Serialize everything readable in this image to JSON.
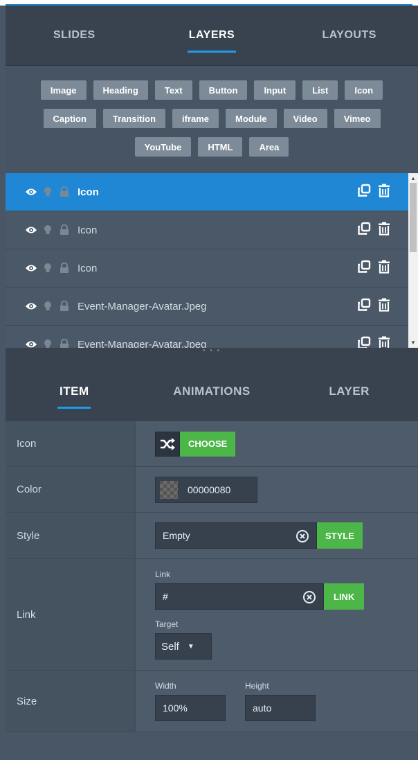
{
  "main_tabs": [
    {
      "label": "SLIDES",
      "active": false
    },
    {
      "label": "LAYERS",
      "active": true
    },
    {
      "label": "LAYOUTS",
      "active": false
    }
  ],
  "elements": {
    "row1": [
      "Image",
      "Heading",
      "Text",
      "Button",
      "Input",
      "List",
      "Icon"
    ],
    "row2": [
      "Caption",
      "Transition",
      "iframe",
      "Module",
      "Video",
      "Vimeo"
    ],
    "row3": [
      "YouTube",
      "HTML",
      "Area"
    ]
  },
  "layers": [
    {
      "name": "Icon",
      "active": true
    },
    {
      "name": "Icon",
      "active": false
    },
    {
      "name": "Icon",
      "active": false
    },
    {
      "name": "Event-Manager-Avatar.Jpeg",
      "active": false
    },
    {
      "name": "Event-Manager-Avatar.Jpeg",
      "active": false
    }
  ],
  "handle": "• • •",
  "sub_tabs": [
    {
      "label": "ITEM",
      "active": true
    },
    {
      "label": "ANIMATIONS",
      "active": false
    },
    {
      "label": "LAYER",
      "active": false
    }
  ],
  "props": {
    "icon": {
      "label": "Icon",
      "button": "CHOOSE"
    },
    "color": {
      "label": "Color",
      "value": "00000080"
    },
    "style": {
      "label": "Style",
      "value": "Empty",
      "button": "STYLE"
    },
    "link": {
      "label": "Link",
      "link_label": "Link",
      "link_value": "#",
      "button": "LINK",
      "target_label": "Target",
      "target_value": "Self"
    },
    "size": {
      "label": "Size",
      "width_label": "Width",
      "width_value": "100%",
      "height_label": "Height",
      "height_value": "auto"
    }
  },
  "colors": {
    "accent": "#1e87d3",
    "green": "#4cb648",
    "panel": "#39434f"
  }
}
